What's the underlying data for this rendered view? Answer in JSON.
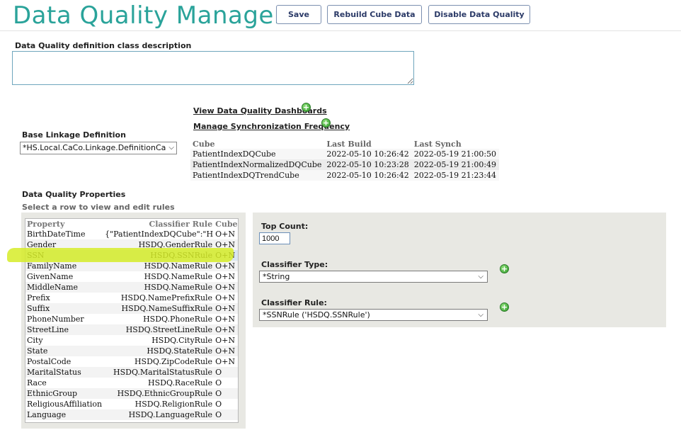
{
  "header": {
    "title": "Data Quality Manager",
    "buttons": {
      "save": "Save",
      "rebuild": "Rebuild Cube Data",
      "disable": "Disable Data Quality"
    }
  },
  "description": {
    "label": "Data Quality definition class description",
    "value": ""
  },
  "linkage": {
    "label": "Base Linkage Definition",
    "selected": "*HS.Local.CaCo.Linkage.DefinitionCa"
  },
  "links": {
    "dashboards": "View Data Quality Dashboards",
    "sync": "Manage Synchronization Frequency"
  },
  "cubes": {
    "headers": [
      "Cube",
      "Last Build",
      "Last Synch"
    ],
    "rows": [
      [
        "PatientIndexDQCube",
        "2022-05-10 10:26:42",
        "2022-05-19 21:00:50"
      ],
      [
        "PatientIndexNormalizedDQCube",
        "2022-05-10 10:23:28",
        "2022-05-19 21:00:49"
      ],
      [
        "PatientIndexDQTrendCube",
        "2022-05-10 10:26:42",
        "2022-05-19 21:23:44"
      ]
    ]
  },
  "properties": {
    "title": "Data Quality Properties",
    "hint": "Select a row to view and edit rules",
    "headers": [
      "Property",
      "Classifier Rule",
      "Cubes"
    ],
    "selected_row": "SSN",
    "rows": [
      [
        "BirthDateTime",
        "{\"PatientIndexDQCube\":\"HS...",
        "O+N"
      ],
      [
        "Gender",
        "HSDQ.GenderRule",
        "O+N"
      ],
      [
        "SSN",
        "HSDQ.SSNRule",
        "O+N"
      ],
      [
        "FamilyName",
        "HSDQ.NameRule",
        "O+N"
      ],
      [
        "GivenName",
        "HSDQ.NameRule",
        "O+N"
      ],
      [
        "MiddleName",
        "HSDQ.NameRule",
        "O+N"
      ],
      [
        "Prefix",
        "HSDQ.NamePrefixRule",
        "O+N"
      ],
      [
        "Suffix",
        "HSDQ.NameSuffixRule",
        "O+N"
      ],
      [
        "PhoneNumber",
        "HSDQ.PhoneRule",
        "O+N"
      ],
      [
        "StreetLine",
        "HSDQ.StreetLineRule",
        "O+N"
      ],
      [
        "City",
        "HSDQ.CityRule",
        "O+N"
      ],
      [
        "State",
        "HSDQ.StateRule",
        "O+N"
      ],
      [
        "PostalCode",
        "HSDQ.ZipCodeRule",
        "O+N"
      ],
      [
        "MaritalStatus",
        "HSDQ.MaritalStatusRule",
        "O"
      ],
      [
        "Race",
        "HSDQ.RaceRule",
        "O"
      ],
      [
        "EthnicGroup",
        "HSDQ.EthnicGroupRule",
        "O"
      ],
      [
        "ReligiousAffiliation",
        "HSDQ.ReligionRule",
        "O"
      ],
      [
        "Language",
        "HSDQ.LanguageRule",
        "O"
      ]
    ]
  },
  "editor": {
    "top_count_label": "Top Count:",
    "top_count_value": "1000",
    "classifier_type_label": "Classifier Type:",
    "classifier_type_value": "*String",
    "classifier_rule_label": "Classifier Rule:",
    "classifier_rule_value": "*SSNRule ('HSDQ.SSNRule')"
  },
  "colors": {
    "title": "#2aa39a",
    "highlight": "#d6ec28",
    "panel": "#e8e8e3"
  }
}
